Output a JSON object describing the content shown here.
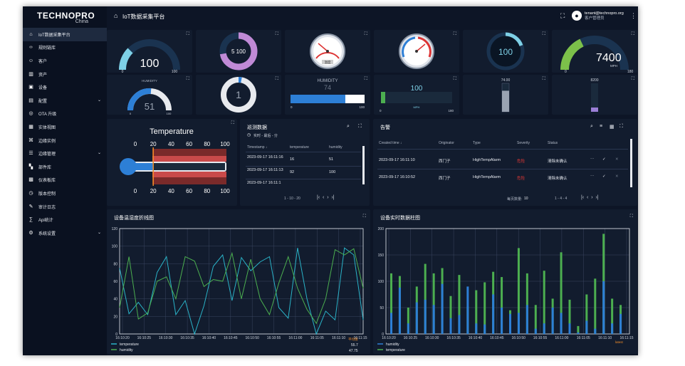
{
  "brand": {
    "name": "TECHNOPRO",
    "sub": "China"
  },
  "header": {
    "title": "IoT数据采集平台",
    "user_email": "tenant@technopro.org",
    "user_role": "客户管理员"
  },
  "menu": [
    {
      "label": "IoT数据采集平台",
      "icon": "home-icon",
      "active": true
    },
    {
      "label": "规则链库",
      "icon": "code-icon"
    },
    {
      "label": "客户",
      "icon": "users-icon"
    },
    {
      "label": "资产",
      "icon": "building-icon"
    },
    {
      "label": "设备",
      "icon": "device-icon"
    },
    {
      "label": "配置",
      "icon": "profile-icon",
      "chevron": true
    },
    {
      "label": "OTA 升级",
      "icon": "update-icon"
    },
    {
      "label": "实体视图",
      "icon": "view-icon"
    },
    {
      "label": "边缘实例",
      "icon": "router-icon"
    },
    {
      "label": "边缘管理",
      "icon": "edge-icon",
      "chevron": true
    },
    {
      "label": "部件库",
      "icon": "widgets-icon"
    },
    {
      "label": "仪表板库",
      "icon": "dashboard-icon"
    },
    {
      "label": "版本控制",
      "icon": "history-icon"
    },
    {
      "label": "审计日志",
      "icon": "audit-icon"
    },
    {
      "label": "Api统计",
      "icon": "api-icon"
    },
    {
      "label": "系统设置",
      "icon": "settings-icon",
      "chevron": true
    }
  ],
  "gauges": {
    "g1": {
      "value": "100",
      "min": "0",
      "max": "100"
    },
    "g2": {
      "value": "5 100"
    },
    "g3": {
      "value": "温度"
    },
    "g5": {
      "value": "100"
    },
    "g6": {
      "value": "7400",
      "unit": "MPH",
      "min": "0",
      "max": "180"
    },
    "g7": {
      "label": "HUMIDITY",
      "value": "51",
      "min": "0",
      "max": "100"
    },
    "g8": {
      "value": "1"
    },
    "g9": {
      "label": "HUMIDITY",
      "value": "74",
      "min": "0",
      "max": "100",
      "level": 0.74
    },
    "g10": {
      "value": "100",
      "unit": "MPH",
      "min": "0",
      "max": "180"
    },
    "g11": {
      "value": "74.00",
      "level": 0.74
    },
    "g12": {
      "value": "8200",
      "level": 0.15
    }
  },
  "thermo": {
    "title": "Temperature",
    "ticks": [
      "0",
      "20",
      "40",
      "60",
      "80",
      "100"
    ],
    "level": 0.2
  },
  "patrol": {
    "title": "巡测数据",
    "subtitle": "实时 - 最后 - 分",
    "cols": [
      "Timestamp ↓",
      "temperature",
      "humidity"
    ],
    "rows": [
      [
        "2023-09-17 16:11:16",
        "16",
        "51"
      ],
      [
        "2023-09-17 16:11:13",
        "92",
        "100"
      ],
      [
        "2023-09-17 16:11:1",
        "",
        ""
      ]
    ],
    "pager": "1 - 10 - 20"
  },
  "alarm": {
    "title": "告警",
    "cols": [
      "Created time ↓",
      "Originator",
      "Type",
      "Severity",
      "Status"
    ],
    "rows": [
      [
        "2023-09-17 16:11:10",
        "西门子",
        "HighTempAlarm",
        "危险",
        "清除未确认"
      ],
      [
        "2023-09-17 16:10:52",
        "西门子",
        "HighTempAlarm",
        "危险",
        "清除未确认"
      ]
    ],
    "page_size_label": "每页数量:",
    "page_size": "10",
    "range": "1 - 4 - 4"
  },
  "line_chart": {
    "title": "设备温湿度折线图",
    "legend_extra": "平均值",
    "stats": [
      "55.7",
      "47.75"
    ]
  },
  "bar_chart": {
    "title": "设备实时数据柱图",
    "latest_label": "latest"
  },
  "chart_data": [
    {
      "type": "line",
      "title": "设备温湿度折线图",
      "ylim": [
        0,
        120
      ],
      "yticks": [
        "0",
        "20",
        "40",
        "60",
        "80",
        "100",
        "120"
      ],
      "categories": [
        "16:10:20",
        "16:10:25",
        "16:10:30",
        "16:10:35",
        "16:10:40",
        "16:10:45",
        "16:10:50",
        "16:10:55",
        "16:11:00",
        "16:11:05",
        "16:11:10",
        "16:11:15"
      ],
      "x": [
        0,
        1,
        2,
        3,
        4,
        5,
        6,
        7,
        8,
        9,
        10,
        11,
        12,
        13,
        14,
        15,
        16,
        17,
        18,
        19,
        20,
        21,
        22,
        23,
        24,
        25,
        26
      ],
      "series": [
        {
          "name": "temperature",
          "color": "#2ab3c8",
          "values": [
            75,
            23,
            36,
            22,
            70,
            88,
            22,
            38,
            0,
            32,
            77,
            90,
            38,
            87,
            72,
            82,
            88,
            30,
            18,
            98,
            40,
            0,
            26,
            16,
            98,
            90,
            16
          ]
        },
        {
          "name": "humidity",
          "color": "#4caf50",
          "values": [
            30,
            88,
            17,
            24,
            60,
            65,
            40,
            88,
            83,
            54,
            62,
            60,
            92,
            40,
            85,
            40,
            22,
            58,
            88,
            52,
            28,
            12,
            40,
            96,
            90,
            97,
            52
          ]
        }
      ]
    },
    {
      "type": "bar",
      "title": "设备实时数据柱图",
      "ylim": [
        0,
        200
      ],
      "yticks": [
        "0",
        "50",
        "100",
        "150",
        "200"
      ],
      "categories": [
        "16:10:20",
        "16:10:25",
        "16:10:30",
        "16:10:35",
        "16:10:40",
        "16:10:45",
        "16:10:50",
        "16:10:55",
        "16:11:00",
        "16:11:05",
        "16:11:10",
        "16:11:15"
      ],
      "series": [
        {
          "name": "humidity",
          "color": "#2d7fd6",
          "values": [
            40,
            88,
            20,
            60,
            65,
            55,
            95,
            30,
            36,
            90,
            20,
            18,
            75,
            50,
            38,
            40,
            55,
            10,
            20,
            50,
            40,
            20,
            3,
            25,
            10,
            100,
            20,
            38
          ]
        },
        {
          "name": "temperature",
          "color": "#4caf50",
          "values": [
            115,
            110,
            50,
            90,
            133,
            115,
            125,
            72,
            112,
            52,
            83,
            98,
            118,
            108,
            45,
            163,
            115,
            55,
            120,
            67,
            155,
            65,
            15,
            75,
            105,
            190,
            67,
            55
          ]
        }
      ]
    }
  ]
}
